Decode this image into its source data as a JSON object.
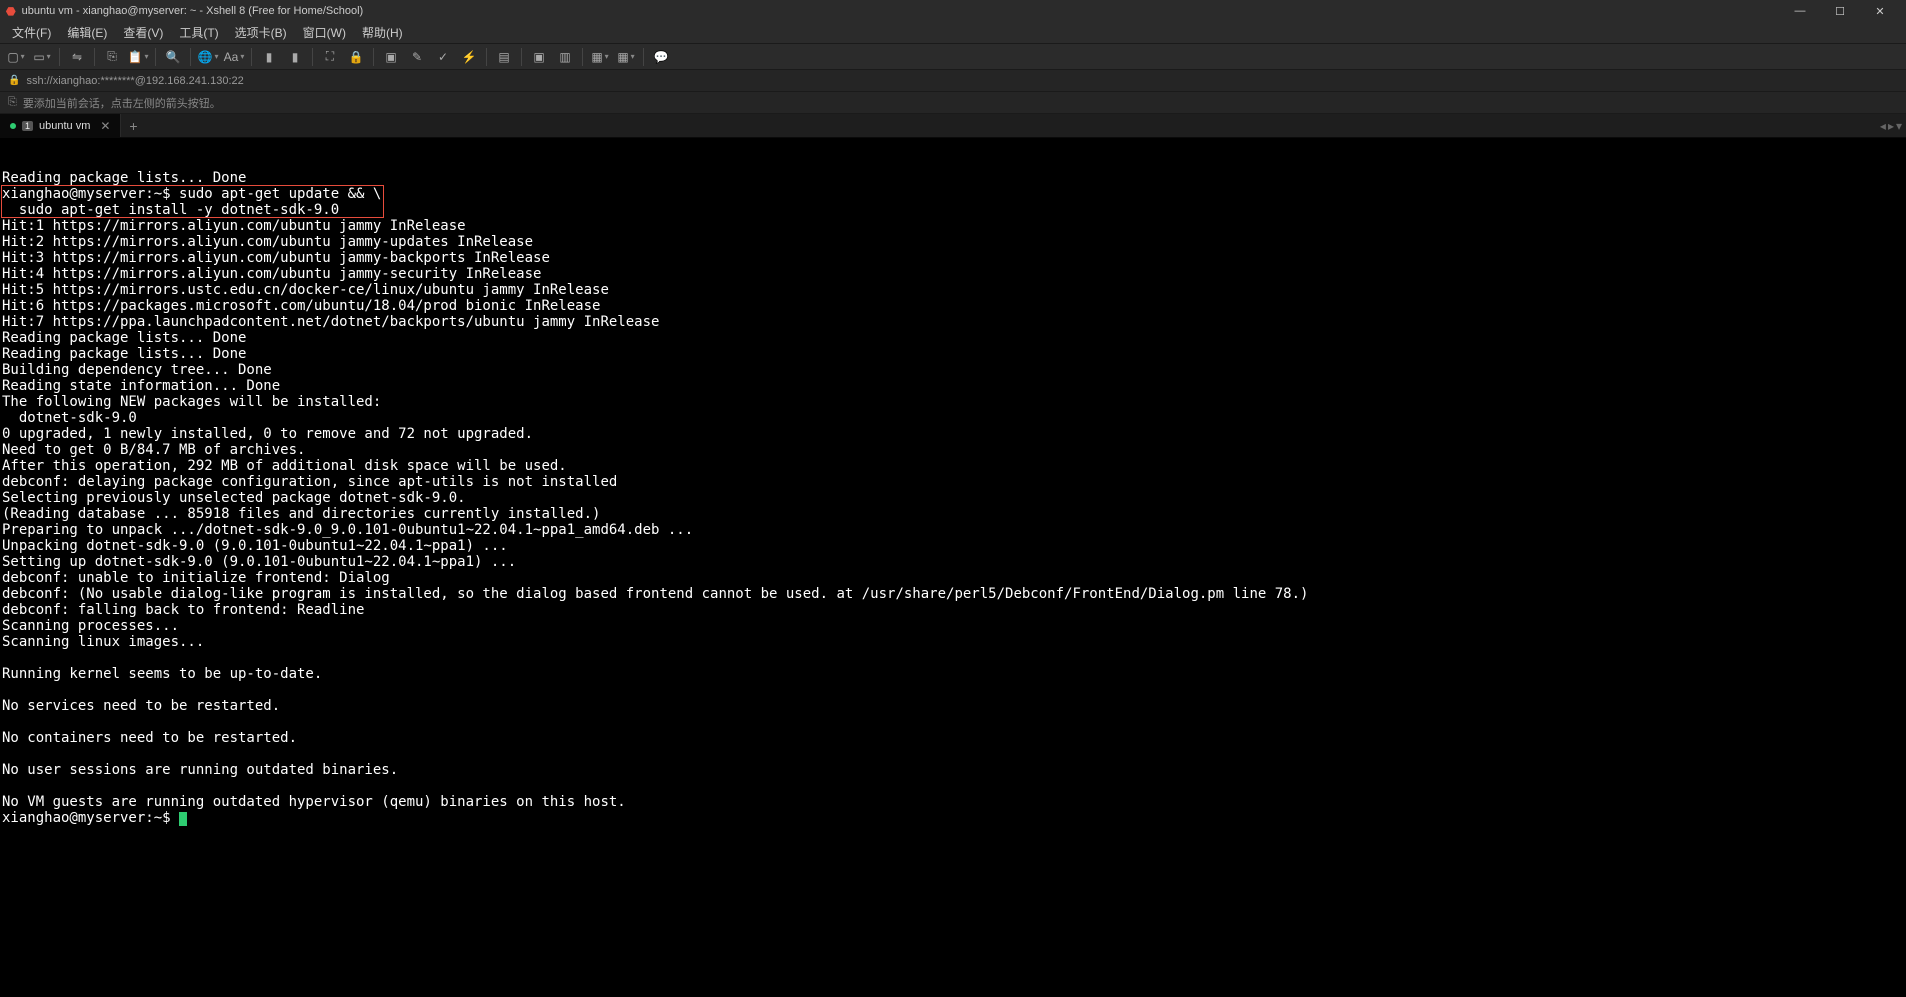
{
  "title": "ubuntu vm - xianghao@myserver: ~ - Xshell 8 (Free for Home/School)",
  "menu": {
    "file": "文件(F)",
    "edit": "编辑(E)",
    "view": "查看(V)",
    "tools": "工具(T)",
    "tabs": "选项卡(B)",
    "window": "窗口(W)",
    "help": "帮助(H)"
  },
  "address": "ssh://xianghao:********@192.168.241.130:22",
  "hint_text": "要添加当前会话，点击左侧的箭头按钮。",
  "tab": {
    "num": "1",
    "label": "ubuntu vm"
  },
  "terminal": {
    "prompt": "xianghao@myserver:~$ ",
    "cmd1": "sudo apt-get update && \\",
    "cmd2": "  sudo apt-get install -y dotnet-sdk-9.0",
    "lines_pre": [
      "Reading package lists... Done"
    ],
    "lines_post": [
      "Hit:1 https://mirrors.aliyun.com/ubuntu jammy InRelease",
      "Hit:2 https://mirrors.aliyun.com/ubuntu jammy-updates InRelease",
      "Hit:3 https://mirrors.aliyun.com/ubuntu jammy-backports InRelease",
      "Hit:4 https://mirrors.aliyun.com/ubuntu jammy-security InRelease",
      "Hit:5 https://mirrors.ustc.edu.cn/docker-ce/linux/ubuntu jammy InRelease",
      "Hit:6 https://packages.microsoft.com/ubuntu/18.04/prod bionic InRelease",
      "Hit:7 https://ppa.launchpadcontent.net/dotnet/backports/ubuntu jammy InRelease",
      "Reading package lists... Done",
      "Reading package lists... Done",
      "Building dependency tree... Done",
      "Reading state information... Done",
      "The following NEW packages will be installed:",
      "  dotnet-sdk-9.0",
      "0 upgraded, 1 newly installed, 0 to remove and 72 not upgraded.",
      "Need to get 0 B/84.7 MB of archives.",
      "After this operation, 292 MB of additional disk space will be used.",
      "debconf: delaying package configuration, since apt-utils is not installed",
      "Selecting previously unselected package dotnet-sdk-9.0.",
      "(Reading database ... 85918 files and directories currently installed.)",
      "Preparing to unpack .../dotnet-sdk-9.0_9.0.101-0ubuntu1~22.04.1~ppa1_amd64.deb ...",
      "Unpacking dotnet-sdk-9.0 (9.0.101-0ubuntu1~22.04.1~ppa1) ...",
      "Setting up dotnet-sdk-9.0 (9.0.101-0ubuntu1~22.04.1~ppa1) ...",
      "debconf: unable to initialize frontend: Dialog",
      "debconf: (No usable dialog-like program is installed, so the dialog based frontend cannot be used. at /usr/share/perl5/Debconf/FrontEnd/Dialog.pm line 78.)",
      "debconf: falling back to frontend: Readline",
      "Scanning processes...",
      "Scanning linux images...",
      "",
      "Running kernel seems to be up-to-date.",
      "",
      "No services need to be restarted.",
      "",
      "No containers need to be restarted.",
      "",
      "No user sessions are running outdated binaries.",
      "",
      "No VM guests are running outdated hypervisor (qemu) binaries on this host."
    ]
  },
  "icons": {
    "app": "⬣",
    "new": "▢",
    "open": "▭",
    "link": "⇋",
    "copy": "⎘",
    "paste": "📋",
    "search": "🔍",
    "globe": "🌐",
    "font": "Aa",
    "flag_g": "▮",
    "flag_o": "▮",
    "fullscreen": "⛶",
    "lock": "🔒",
    "edit": "✎",
    "check": "✓",
    "bolt": "⚡",
    "box1": "▣",
    "box2": "▤",
    "box3": "▥",
    "grid": "▦",
    "chat": "💬",
    "hint": "⎘",
    "min": "—",
    "max": "☐",
    "close": "✕",
    "plus": "+"
  }
}
